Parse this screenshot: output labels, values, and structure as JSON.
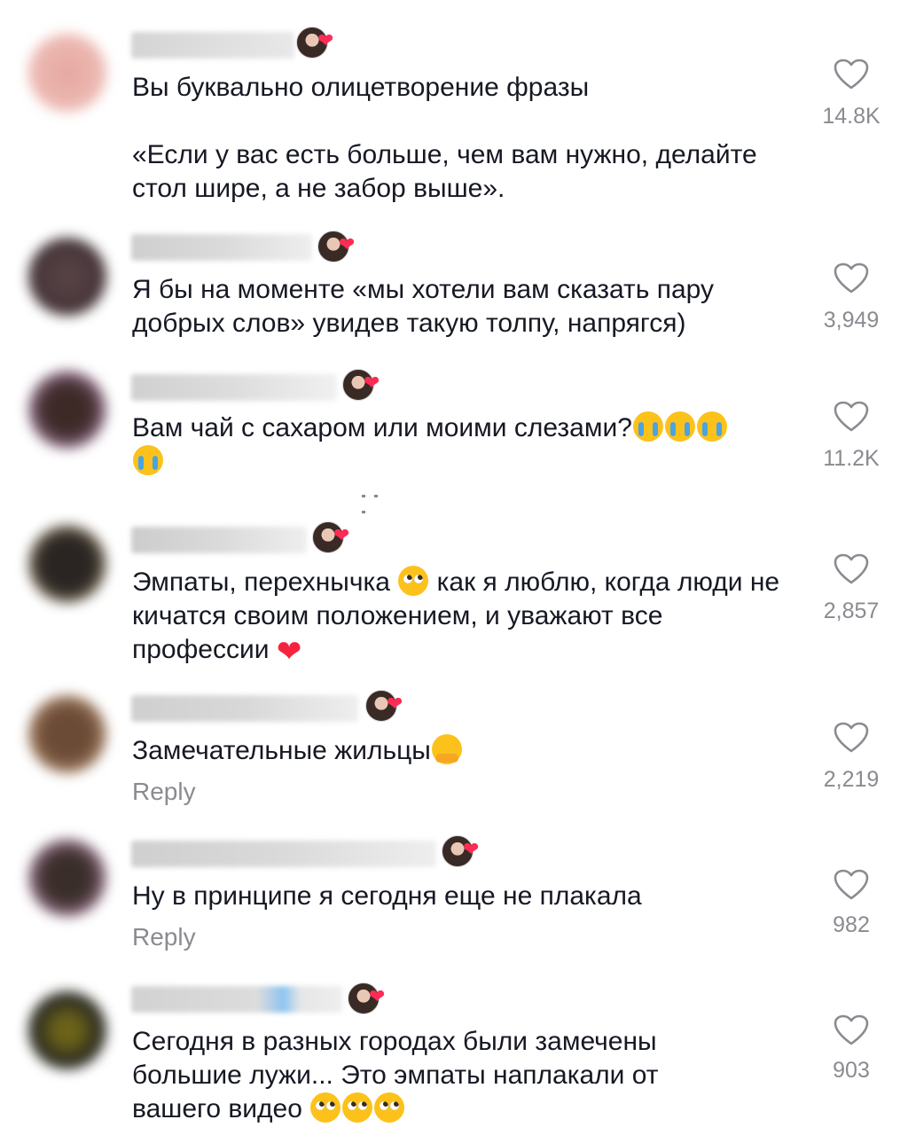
{
  "comments": [
    {
      "text_parts": [
        "Вы буквально олицетворение фразы\n\n«Если у вас есть больше, чем вам нужно, делайте стол шире, а не забор выше»."
      ],
      "likes": "14.8K",
      "reply": ""
    },
    {
      "text_parts": [
        "Я бы на моменте «мы хотели вам сказать пару добрых слов» увидев такую толпу, напрягся)"
      ],
      "likes": "3,949",
      "reply": ""
    },
    {
      "text_parts": [
        "Вам чай с сахаром или моими слезами?"
      ],
      "likes": "11.2K",
      "reply": ""
    },
    {
      "text_parts": [
        "Эмпаты, перехнычка ",
        " как я люблю, когда люди не кичатся своим положением, и уважают все профессии "
      ],
      "likes": "2,857",
      "reply": ""
    },
    {
      "text_parts": [
        "Замечательные жильцы"
      ],
      "likes": "2,219",
      "reply": "Reply"
    },
    {
      "text_parts": [
        "Ну в принципе я сегодня еще не плакала"
      ],
      "likes": "982",
      "reply": "Reply"
    },
    {
      "text_parts": [
        "Сегодня в разных городах были замечены большие лужи... Это эмпаты наплакали от вашего видео "
      ],
      "likes": "903",
      "reply": ""
    }
  ],
  "emoji": {
    "crying": "loudly-crying-face-emoji",
    "pleading": "pleading-face-emoji",
    "hugging": "hugging-face-emoji",
    "heart": "❤",
    "creator_heart": "❤"
  },
  "colors": {
    "text": "#161823",
    "muted": "#8a8b91",
    "like_heart_outline": "#8a8b91",
    "creator_heart": "#fe2c55",
    "red_heart": "#f4243e",
    "emoji_yellow": "#fcc21b",
    "tear_blue": "#4ba3e3"
  },
  "icons": {
    "like": "heart-outline-icon",
    "creator_badge": "creator-liked-icon"
  }
}
